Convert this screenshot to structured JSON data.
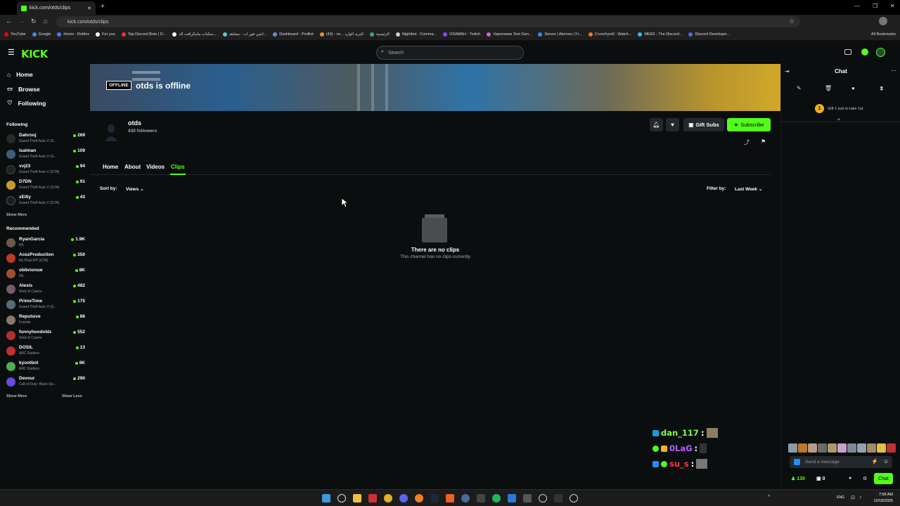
{
  "browser": {
    "tab_title": "kick.com/otds/clips",
    "url": "kick.com/otds/clips",
    "bookmarks": [
      "YouTube",
      "Google",
      "Home - Roblox",
      "For you",
      "Top Discord Bots | D...",
      "سكنات ماينكرافت الذ...",
      "انمي فور اب - مشاهد...",
      "Dashboard - ProBot",
      "(43) - os... البريد الوارد",
      "الرئيسية",
      "Nightbot - Comma...",
      "OSAMAH - Twitch",
      "Vaporwave Text Gen...",
      "Server | Aternos | Fr...",
      "Crunchyroll - Watch...",
      "MEE6 - The Discord...",
      "Discord Developer..."
    ],
    "all_bookmarks": "All Bookmarks"
  },
  "header": {
    "logo": "KICK",
    "search_placeholder": "Search"
  },
  "sidebar": {
    "nav": [
      "Home",
      "Browse",
      "Following"
    ],
    "following_title": "Following",
    "following": [
      {
        "name": "Dahrooj",
        "category": "Grand Theft Auto V (G...",
        "viewers": "269",
        "color": "#2a2a2a"
      },
      {
        "name": "Isalman",
        "category": "Grand Theft Auto V (G...",
        "viewers": "109",
        "color": "#3b5f7a"
      },
      {
        "name": "vvj23",
        "category": "Grand Theft Auto V (GTA)",
        "viewers": "94",
        "color": "#222"
      },
      {
        "name": "D7DN",
        "category": "Grand Theft Auto V (GTA)",
        "viewers": "91",
        "color": "#c79a2c"
      },
      {
        "name": "xEllly",
        "category": "Grand Theft Auto V (GTA)",
        "viewers": "43",
        "color": "#1a1a2a"
      }
    ],
    "show_more_1": "Show More",
    "recommended_title": "Recommended",
    "recommended": [
      {
        "name": "RyanGarcia",
        "category": "IRL",
        "viewers": "1.9K",
        "color": "#6b5a4a"
      },
      {
        "name": "AcezProduction",
        "category": "No Pixel RP (GTA)",
        "viewers": "350",
        "color": "#c0392b"
      },
      {
        "name": "oblivionsw",
        "category": "IRL",
        "viewers": "8K",
        "color": "#a0522d"
      },
      {
        "name": "Alexis",
        "category": "Slots & Casino",
        "viewers": "482",
        "color": "#7a5a6a"
      },
      {
        "name": "PrimeTime",
        "category": "Grand Theft Auto V (G...",
        "viewers": "175",
        "color": "#5a6a7a"
      },
      {
        "name": "Repulsive",
        "category": "Fortnite",
        "viewers": "86",
        "color": "#8a7a6a"
      },
      {
        "name": "funnyhoodvidz",
        "category": "Slots & Casino",
        "viewers": "552",
        "color": "#b03030"
      },
      {
        "name": "DOSIL",
        "category": "ARC Raiders",
        "viewers": "13",
        "color": "#c03030"
      },
      {
        "name": "kyootbot",
        "category": "ARC Raiders",
        "viewers": "6K",
        "color": "#4caf50"
      },
      {
        "name": "Devour",
        "category": "Call of Duty: Black Op...",
        "viewers": "290",
        "color": "#6a4adf"
      }
    ],
    "show_more_2": "Show More",
    "show_less": "Show Less"
  },
  "banner": {
    "badge": "OFFLINE",
    "title": "otds is offline"
  },
  "channel": {
    "name": "otds",
    "followers": "430 followers",
    "gift_label": "Gift Subs",
    "subscribe_label": "Subscribe"
  },
  "tabs": [
    "Home",
    "About",
    "Videos",
    "Clips"
  ],
  "filters": {
    "sort_label": "Sort by:",
    "sort_value": "Views",
    "filter_label": "Filter by:",
    "filter_value": "Last Week"
  },
  "empty": {
    "title": "There are no clips",
    "subtitle": "This channel has no clips currently"
  },
  "chat": {
    "title": "Chat",
    "gift_text": "Gift 1 sub to take 1st",
    "gift_rank": "1",
    "message_placeholder": "Send a message",
    "viewers": "130",
    "count": "0",
    "send_label": "Chat"
  },
  "overlay_chat": [
    {
      "user": "dan_117",
      "sep": ":",
      "color": "#7dff4f"
    },
    {
      "user": "0LaG",
      "sep": ":",
      "color": "#b85fff"
    },
    {
      "user": "su_s",
      "sep": ":",
      "color": "#ff3b3b"
    }
  ],
  "taskbar": {
    "lang": "ENG",
    "time": "7:58 AM",
    "date": "12/18/2025"
  },
  "colors": {
    "accent": "#53fc18",
    "bg": "#0b0e0f",
    "panel": "#24272c"
  }
}
